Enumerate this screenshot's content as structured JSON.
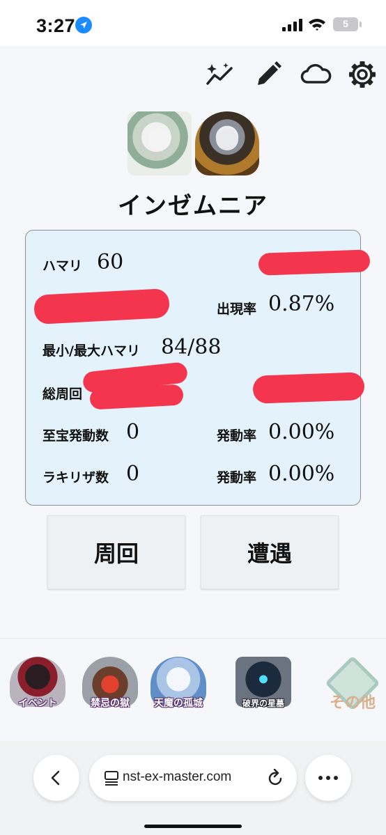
{
  "status_bar": {
    "time": "3:27",
    "battery": "5"
  },
  "toolbar": {
    "icons": [
      "sparkle-chart-icon",
      "pencil-icon",
      "cloud-icon",
      "gear-icon"
    ]
  },
  "character": {
    "name": "インゼムニア"
  },
  "stats": {
    "hamari_label": "ハマリ",
    "hamari_value": "60",
    "appearance_rate_label": "出現率",
    "appearance_rate_value": "0.87%",
    "minmax_label": "最小/最大ハマリ",
    "minmax_value": "84/88",
    "total_laps_label": "総周回",
    "shihou_label": "至宝発動数",
    "shihou_value": "0",
    "shihou_rate_label": "発動率",
    "shihou_rate_value": "0.00%",
    "rakirisa_label": "ラキリザ数",
    "rakirisa_value": "0",
    "rakirisa_rate_label": "発動率",
    "rakirisa_rate_value": "0.00%"
  },
  "buttons": {
    "lap": "周回",
    "encounter": "遭遇"
  },
  "bottom_nav": [
    {
      "label": "イベント"
    },
    {
      "label": "禁忌の獄"
    },
    {
      "label": "天魔の孤城"
    },
    {
      "label": "破界の星墓"
    },
    {
      "label": "その他"
    }
  ],
  "browser": {
    "url": "nst-ex-master.com"
  },
  "colors": {
    "card_bg": "#e4f3fb",
    "redaction": "#f4354e",
    "location_blue": "#1a8cff"
  }
}
